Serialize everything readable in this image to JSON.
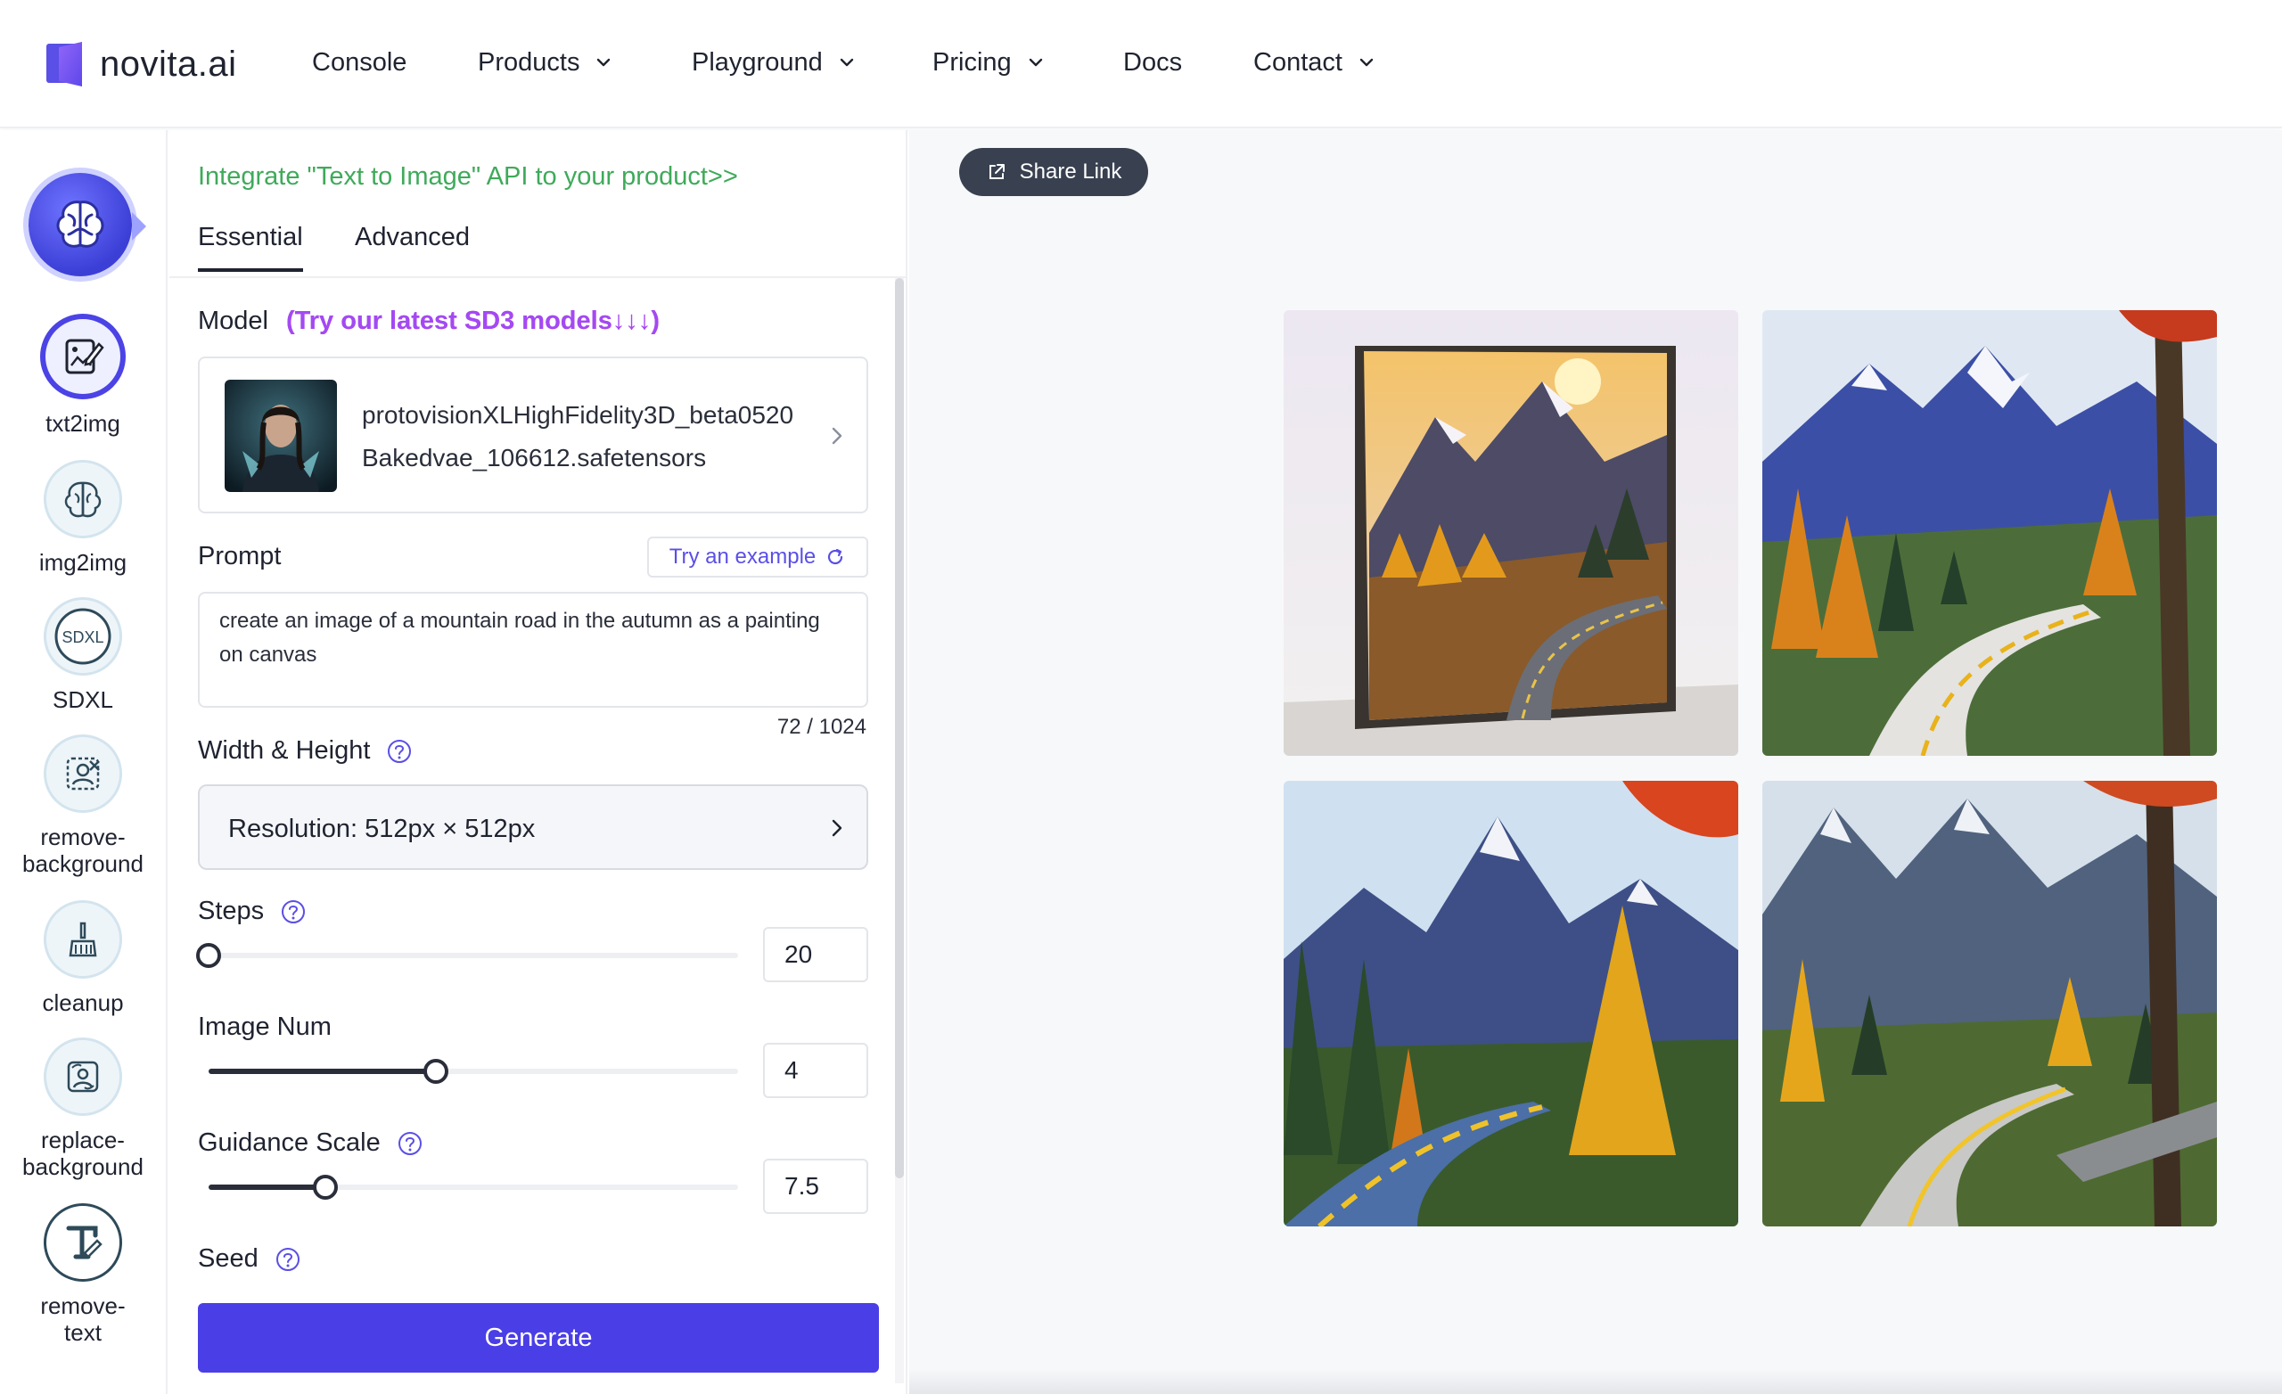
{
  "brand": {
    "name": "novita.ai"
  },
  "nav": {
    "console": "Console",
    "products": "Products",
    "playground": "Playground",
    "pricing": "Pricing",
    "docs": "Docs",
    "contact": "Contact"
  },
  "tools": {
    "txt2img": "txt2img",
    "img2img": "img2img",
    "sdxl": "SDXL",
    "sdxl_badge": "SDXL",
    "remove_background": "remove-\nbackground",
    "cleanup": "cleanup",
    "replace_background": "replace-\nbackground",
    "remove_text": "remove-\ntext"
  },
  "panel": {
    "integrate_link": "Integrate \"Text to Image\" API to your product>>",
    "tabs": {
      "essential": "Essential",
      "advanced": "Advanced"
    },
    "model_label": "Model",
    "model_promo": "(Try our latest SD3 models↓↓↓)",
    "model_name": "protovisionXLHighFidelity3D_beta0520Bakedvae_106612.safetensors",
    "prompt_label": "Prompt",
    "try_example": "Try an example",
    "prompt_text": "create an image of a mountain road in the autumn as a painting on canvas",
    "prompt_counter": "72 / 1024",
    "size_label": "Width & Height",
    "resolution": "Resolution: 512px × 512px",
    "steps_label": "Steps",
    "steps_value": "20",
    "image_num_label": "Image Num",
    "image_num_value": "4",
    "guidance_label": "Guidance Scale",
    "guidance_value": "7.5",
    "seed_label": "Seed",
    "generate": "Generate"
  },
  "sliders": {
    "steps_fraction": 0.0,
    "image_num_fraction": 0.43,
    "guidance_fraction": 0.22
  },
  "result": {
    "share": "Share Link"
  },
  "colors": {
    "accent": "#4a3ee6",
    "integrate_link": "#3faa5a",
    "promo": "#a449f2",
    "share_bg": "#394150"
  },
  "icons": [
    "brand-logo-icon",
    "chevron-down-icon",
    "brain-icon",
    "edit-image-icon",
    "image-to-image-icon",
    "sdxl-icon",
    "remove-background-icon",
    "cleanup-icon",
    "replace-background-icon",
    "remove-text-icon",
    "chevron-right-icon",
    "refresh-icon",
    "help-icon",
    "share-icon"
  ]
}
